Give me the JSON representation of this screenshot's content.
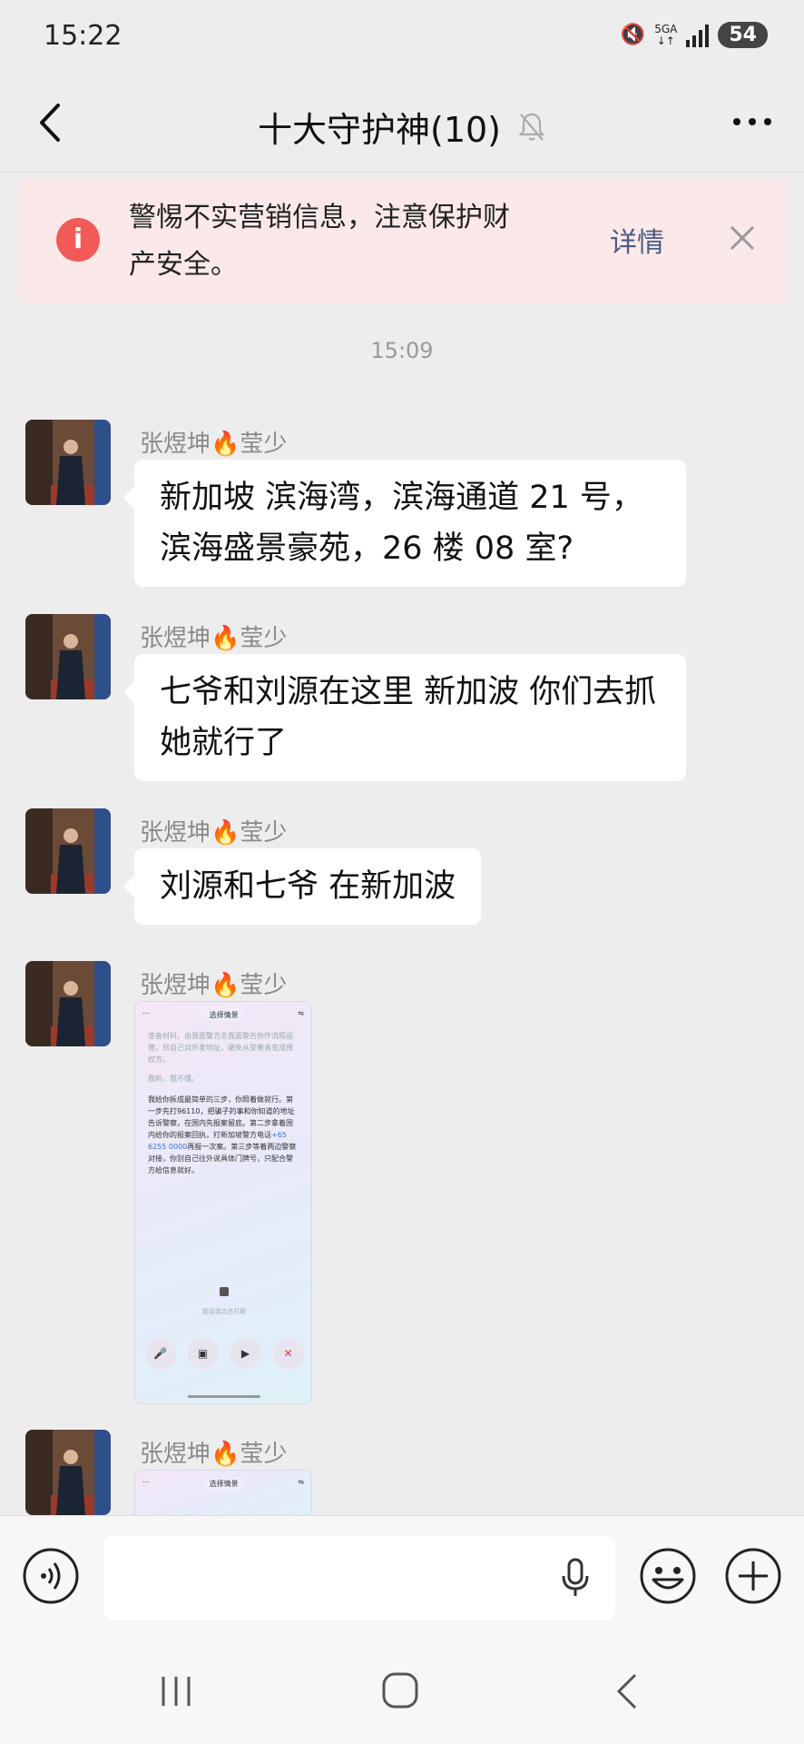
{
  "status_bar": {
    "time": "15:22",
    "network": "5GA",
    "battery": "54"
  },
  "header": {
    "title": "十大守护神(10)"
  },
  "warning": {
    "icon": "i",
    "text": "警惕不实营销信息，注意保护财产安全。",
    "detail_label": "详情"
  },
  "timestamp": "15:09",
  "messages": [
    {
      "sender_name": "张煜坤",
      "sender_emoji": "🔥",
      "sender_suffix": "莹少",
      "text": "新加坡 滨海湾，滨海通道 21 号，滨海盛景豪苑，26 楼 08 室?"
    },
    {
      "sender_name": "张煜坤",
      "sender_emoji": "🔥",
      "sender_suffix": "莹少",
      "text": "七爷和刘源在这里 新加波 你们去抓她就行了"
    },
    {
      "sender_name": "张煜坤",
      "sender_emoji": "🔥",
      "sender_suffix": "莹少",
      "text": "刘源和七爷 在新加波"
    },
    {
      "sender_name": "张煜坤",
      "sender_emoji": "🔥",
      "sender_suffix": "莹少",
      "image": {
        "pill": "选择情景",
        "faint": "准备材料，由我面警方走我面警告你作流程运营。到自己对外发地址，避免从受害者变成侵权方。",
        "faint2": "我听，我不懂。",
        "body1": "我给你拆成最简单的三步，你照着做就行。第一步先打96110，把骗子的事和你知道的地址告诉警察，在国内先报案留底。第二步拿着国内给你的报案回执，打新加坡警方电话",
        "phone": "+65 6255 0000",
        "body2": "再报一次案。第三步等着两边警察对接，你别自己往外说具体门牌号，只配合警方给信息就好。",
        "mid_text": "说话或点击打断"
      }
    },
    {
      "sender_name": "张煜坤",
      "sender_emoji": "🔥",
      "sender_suffix": "莹少",
      "image": {
        "pill": "选择情景"
      }
    }
  ],
  "input": {
    "placeholder": ""
  }
}
